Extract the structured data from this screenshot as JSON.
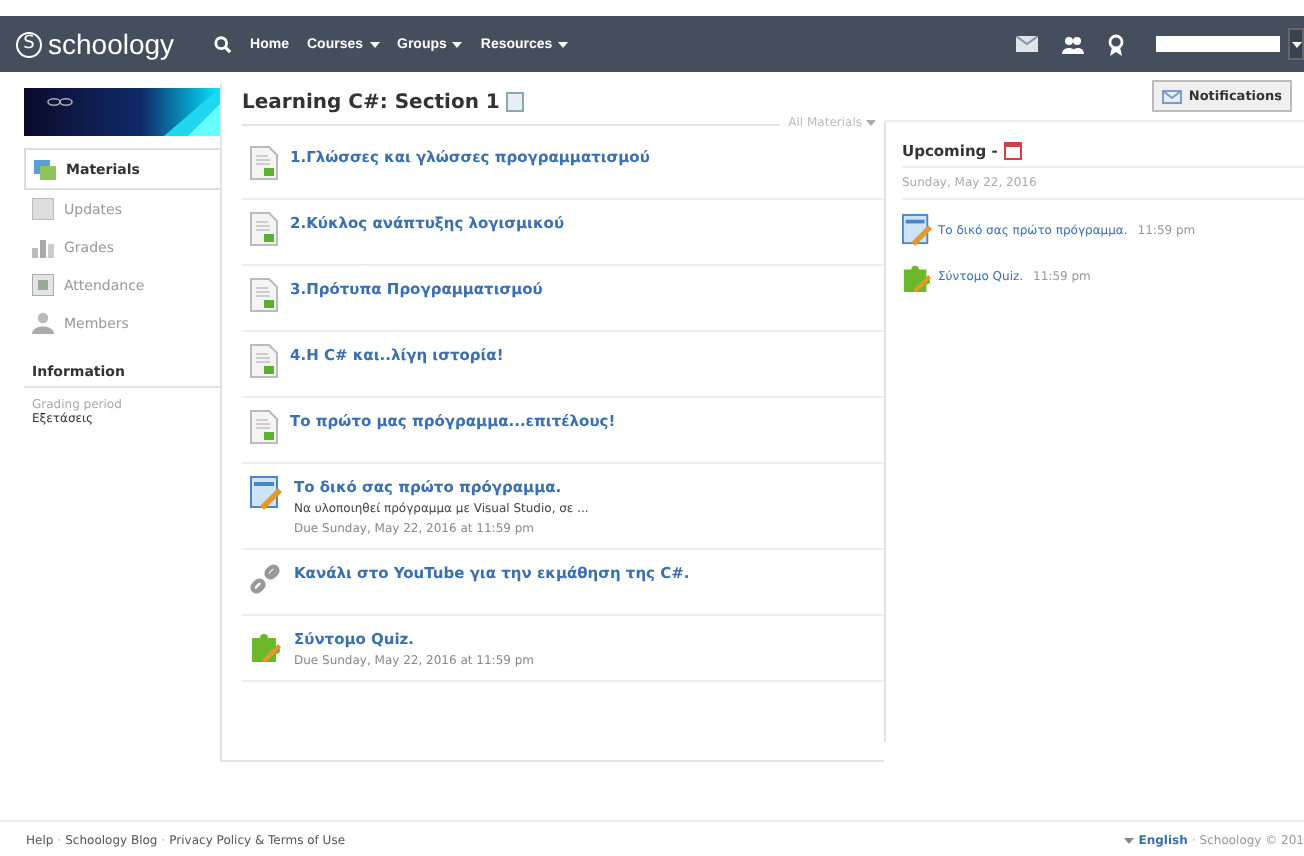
{
  "header": {
    "logo_mark": "S",
    "logo_text": "schoology",
    "nav": [
      {
        "label": "Home",
        "dropdown": false
      },
      {
        "label": "Courses",
        "dropdown": true
      },
      {
        "label": "Groups",
        "dropdown": true
      },
      {
        "label": "Resources",
        "dropdown": true
      }
    ]
  },
  "sidebar": {
    "items": [
      {
        "label": "Materials",
        "kind": "materials",
        "selected": true
      },
      {
        "label": "Updates",
        "kind": "updates",
        "selected": false
      },
      {
        "label": "Grades",
        "kind": "grades",
        "selected": false
      },
      {
        "label": "Attendance",
        "kind": "attendance",
        "selected": false
      },
      {
        "label": "Members",
        "kind": "members",
        "selected": false
      }
    ],
    "information": {
      "heading": "Information",
      "label": "Grading period",
      "value": "Εξετάσεις"
    }
  },
  "main": {
    "title": "Learning C#: Section 1",
    "filter": "All Materials",
    "materials": [
      {
        "kind": "document",
        "title": "1.Γλώσσες και γλώσσες προγραμματισμού"
      },
      {
        "kind": "document",
        "title": "2.Κύκλος ανάπτυξης λογισμικού"
      },
      {
        "kind": "document",
        "title": "3.Πρότυπα Προγραμματισμού"
      },
      {
        "kind": "document",
        "title": "4.Η C# και..λίγη ιστορία!"
      },
      {
        "kind": "document",
        "title": "Το πρώτο μας πρόγραμμα...επιτέλους!"
      },
      {
        "kind": "assignment",
        "title": "Το δικό σας πρώτο πρόγραμμα.",
        "description": "Να υλοποιηθεί πρόγραμμα με Visual Studio, σε ...",
        "due": "Due Sunday, May 22, 2016 at 11:59 pm"
      },
      {
        "kind": "link",
        "title": "Κανάλι στο YouTube για την εκμάθηση της C#."
      },
      {
        "kind": "quiz",
        "title": "Σύντομο Quiz.",
        "due": "Due Sunday, May 22, 2016 at 11:59 pm"
      }
    ]
  },
  "notifications_button": "Notifications",
  "upcoming": {
    "heading": "Upcoming -",
    "date": "Sunday, May 22, 2016",
    "events": [
      {
        "kind": "assignment",
        "title": "Το δικό σας πρώτο πρόγραμμα.",
        "time": "11:59 pm"
      },
      {
        "kind": "quiz",
        "title": "Σύντομο Quiz.",
        "time": "11:59 pm"
      }
    ]
  },
  "footer": {
    "left": [
      {
        "kind": "link",
        "text": "Help"
      },
      {
        "kind": "separator",
        "text": "·"
      },
      {
        "kind": "link",
        "text": "Schoology Blog"
      },
      {
        "kind": "separator",
        "text": "·"
      },
      {
        "kind": "link",
        "text": "Privacy Policy & Terms of Use"
      }
    ],
    "right": [
      {
        "kind": "language",
        "text": "English"
      },
      {
        "kind": "separator",
        "text": "·"
      },
      {
        "kind": "text",
        "text": "Schoology © 201"
      }
    ]
  }
}
